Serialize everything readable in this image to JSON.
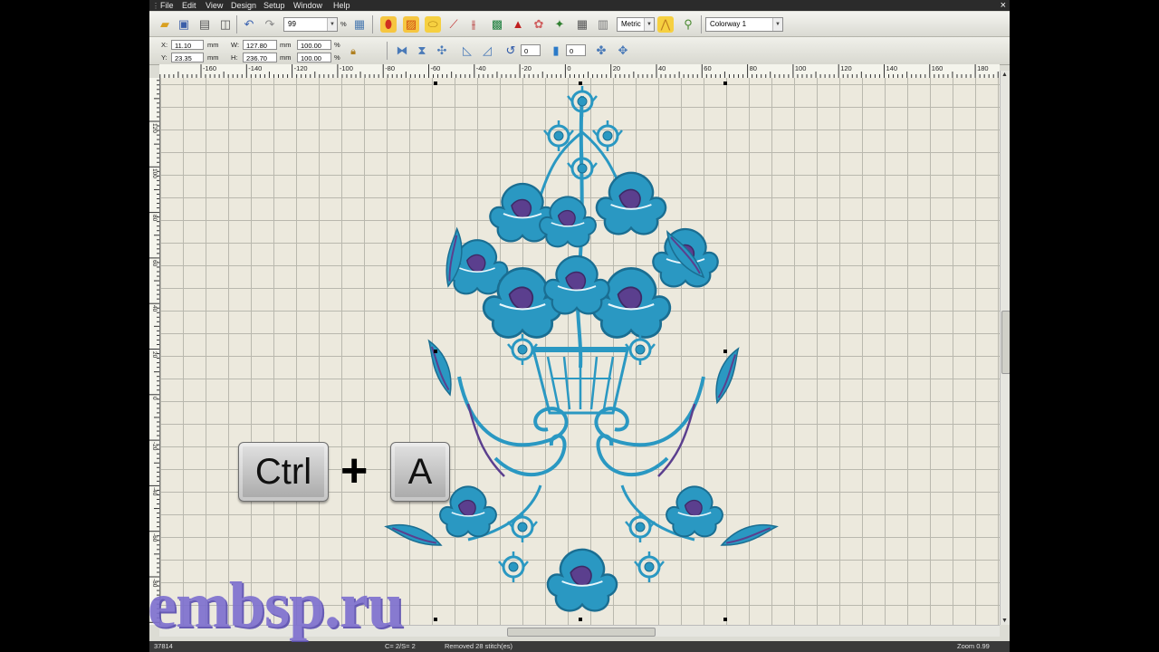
{
  "menubar": {
    "items": [
      "File",
      "Edit",
      "View",
      "Design",
      "Setup",
      "Window",
      "Help"
    ],
    "close_glyph": "×"
  },
  "toolbar1": {
    "zoom_value": "99",
    "zoom_unit": "%",
    "units_value": "Metric",
    "colorway_value": "Colorway 1",
    "icons": [
      "open-folder-icon",
      "save-icon",
      "print-icon",
      "print-preview-icon",
      "undo-icon",
      "redo-icon",
      "zoom-options-icon",
      "satin-stitch-icon",
      "fill-stitch-icon",
      "outline-icon",
      "run-stitch-icon",
      "needle-icon",
      "image-icon",
      "color-icon",
      "applique-icon",
      "lettering-icon",
      "grid-icon",
      "hoop-grid-icon",
      "measure-icon",
      "thread-icon"
    ]
  },
  "toolbar2": {
    "x_label": "X:",
    "x_value": "11.10",
    "x_unit": "mm",
    "y_label": "Y:",
    "y_value": "23.35",
    "y_unit": "mm",
    "w_label": "W:",
    "w_value": "127.80",
    "w_unit": "mm",
    "h_label": "H:",
    "h_value": "236.70",
    "h_unit": "mm",
    "sw_value": "100.00",
    "sw_unit": "%",
    "sh_value": "100.00",
    "sh_unit": "%",
    "rotate_value": "0",
    "slant_value": "0",
    "icons": [
      "lock-proportion-icon",
      "mirror-horizontal-icon",
      "mirror-vertical-icon",
      "arrange-icon",
      "skew-left-icon",
      "skew-right-icon",
      "rotate-left-icon",
      "slant-icon",
      "align-icon",
      "distribute-icon"
    ]
  },
  "ruler_h": [
    "-160",
    "-140",
    "-120",
    "-100",
    "-80",
    "-60",
    "-40",
    "-20",
    "0",
    "20",
    "40",
    "60",
    "80",
    "100",
    "120",
    "140",
    "160",
    "180"
  ],
  "ruler_v": [
    "120",
    "100",
    "80",
    "60",
    "40",
    "20",
    "0",
    "-20",
    "-40",
    "-60",
    "-80"
  ],
  "overlay": {
    "ctrl_key": "Ctrl",
    "plus": "+",
    "a_key": "A"
  },
  "watermark": "embsp.ru",
  "status": {
    "stitch_count": "37814",
    "color_info": "C= 2/S= 2",
    "message": "Removed 28 stitch(es)",
    "zoom": "Zoom 0.99"
  },
  "colors": {
    "embroidery_blue": "#2a98c2",
    "embroidery_purple": "#5b3f8e",
    "canvas": "#ece9dd",
    "watermark": "#7d6fcf"
  }
}
